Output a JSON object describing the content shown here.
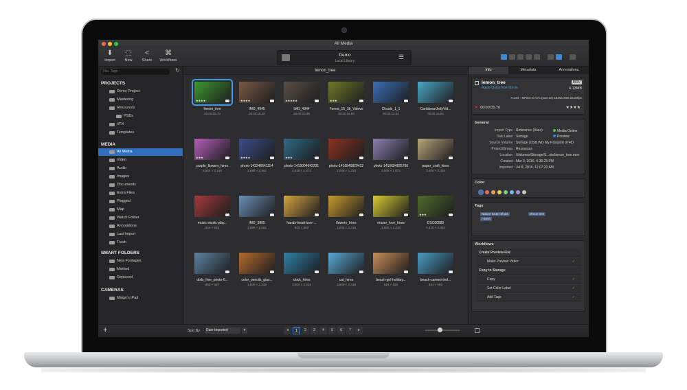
{
  "window": {
    "title": "All Media"
  },
  "toolbar": {
    "buttons": [
      {
        "label": "Import",
        "icon": "import-icon"
      },
      {
        "label": "New",
        "icon": "new-icon"
      },
      {
        "label": "Share",
        "icon": "share-icon"
      },
      {
        "label": "Workflows",
        "icon": "workflows-icon"
      }
    ],
    "library": {
      "name": "Demo",
      "subtitle": "Local Library"
    }
  },
  "sidebar": {
    "search_placeholder": "File, Tags",
    "sections": {
      "projects": "PROJECTS",
      "media": "MEDIA",
      "smart_folders": "SMART FOLDERS",
      "cameras": "CAMERAS"
    },
    "projects": [
      "Demo Project",
      "Mastering",
      "Resources",
      "PSDs",
      "VFX",
      "Templates"
    ],
    "media": [
      "All Media",
      "Video",
      "Audio",
      "Images",
      "Documents",
      "Extra Files",
      "Flagged",
      "Map",
      "Watch Folder",
      "Annotations",
      "Last Import",
      "Trash"
    ],
    "smart_folders": [
      "New Footages",
      "Marked",
      "Replaced"
    ],
    "cameras": [
      "Maign's iPad"
    ]
  },
  "center": {
    "breadcrumb": "lemon_tree",
    "items": [
      {
        "name": "lemon_tree",
        "sub": "00:00:05.76",
        "stars": "★★★★",
        "color": "#3d9a2f"
      },
      {
        "name": "IMG_4945",
        "sub": "00:00:18.26",
        "stars": "★★★★",
        "color": "#7a5a44"
      },
      {
        "name": "IMG_4944",
        "sub": "00:00:10.86",
        "stars": "★★★★★",
        "color": "#5a4f48"
      },
      {
        "name": "Forest_15_3b_Videvo",
        "sub": "00:00:16.64",
        "stars": "★★★",
        "color": "#6f7a28"
      },
      {
        "name": "Clouds_1_1",
        "sub": "00:00:12.52",
        "stars": "",
        "color": "#3b6fb8"
      },
      {
        "name": "CaribbeanJettyVid...",
        "sub": "00:00:16.64",
        "stars": "",
        "color": "#4aa6c8"
      },
      {
        "name": "purple_flowers_hires",
        "sub": "3,500 × 2,318",
        "stars": "★★★",
        "color": "#b45fb9"
      },
      {
        "name": "photo-142346641154",
        "sub": "3,888 × 2,592",
        "stars": "★★★★",
        "color": "#3c4e88"
      },
      {
        "name": "photo-1419004642331",
        "sub": "2,539 × 1,673",
        "stars": "★★★",
        "color": "#2f6a86"
      },
      {
        "name": "photo-1416849829422",
        "sub": "2,000 × 1,333",
        "stars": "",
        "color": "#8a3320"
      },
      {
        "name": "photo-1416694825760",
        "sub": "2,508 × 1,673",
        "stars": "",
        "color": "#8a7fb0"
      },
      {
        "name": "paper_craft_hires",
        "sub": "3,500 × 2,318",
        "stars": "",
        "color": "#b9a37a"
      },
      {
        "name": "music-music-play...",
        "sub": "824 × 550",
        "stars": "",
        "color": "#a33a3a"
      },
      {
        "name": "IMG_3865",
        "sub": "3,888 × 2,592",
        "stars": "",
        "color": "#6b8fb5"
      },
      {
        "name": "hands-heart-love-...",
        "sub": "824 × 550",
        "stars": "",
        "color": "#d4a341"
      },
      {
        "name": "flowers_hires",
        "sub": "3,500 × 2,318",
        "stars": "",
        "color": "#c79b2c"
      },
      {
        "name": "eraser_love_hires",
        "sub": "3,500 × 2,318",
        "stars": "",
        "color": "#d9cc2f"
      },
      {
        "name": "DSC00580",
        "sub": "4,310 × 2,864",
        "stars": "★★★",
        "color": "#4f6b2c"
      },
      {
        "name": "dolls_free_photo-6...",
        "sub": "660 × 457",
        "stars": "",
        "color": "#5b83a3"
      },
      {
        "name": "color_pencils_glas...",
        "sub": "3,500 × 2,318",
        "stars": "",
        "color": "#b46a2d"
      },
      {
        "name": "clock_hires",
        "sub": "3,500 × 2,318",
        "stars": "",
        "color": "#2f7fa8"
      },
      {
        "name": "cat_hires",
        "sub": "3,500 × 2,318",
        "stars": "",
        "color": "#5aa9d6"
      },
      {
        "name": "beach-girl-holiday...",
        "sub": "824 × 550",
        "stars": "",
        "color": "#c98d56"
      },
      {
        "name": "beach-camera-hol...",
        "sub": "824 × 550",
        "stars": "",
        "color": "#4a9cc3"
      }
    ]
  },
  "inspector": {
    "tabs": [
      "Info",
      "Metadata",
      "Annotations"
    ],
    "file": {
      "name": "lemon_tree",
      "badge": "MOV",
      "kind": "Apple QuickTime Movie",
      "size": "4.13MB",
      "codec": "H.264 - MPEG-4 AVC (part 10) 1920x1080 25.00fps",
      "duration": "00:00:05.76",
      "stars": "★★★★"
    },
    "general": {
      "title": "General",
      "rows": [
        {
          "k": "Import Type :",
          "v": "Reference (Alias)"
        },
        {
          "k": "Disk Label :",
          "v": "Storage"
        },
        {
          "k": "Source Volume :",
          "v": "Storage (USB WD My Passport 0748)"
        },
        {
          "k": "Project/Group :",
          "v": "Resources"
        },
        {
          "k": "Location :",
          "v": "/Volumes/Storage/S...ots/lemon_tree.mov"
        },
        {
          "k": "Created :",
          "v": "Mar 3, 2016, 6:36:25 PM"
        },
        {
          "k": "Imported :",
          "v": "Jul 8, 2016, 11:07:20 AM"
        }
      ],
      "status_online": "Media Online",
      "status_preview": "Preview"
    },
    "color": {
      "title": "Color",
      "swatches": [
        "#5a6f8f",
        "#e26b6b",
        "#e8a35a",
        "#e3d466",
        "#7fcf7a",
        "#79b8e8",
        "#a88fe0",
        "#c7c7c7"
      ]
    },
    "tags": {
      "title": "Tags",
      "items": [
        "Nature Insert Shots",
        "lemon tree",
        "Forest"
      ]
    },
    "workflows": {
      "title": "Workflows",
      "items": [
        {
          "label": "Create Preview File",
          "group": true
        },
        {
          "label": "Make Preview Video",
          "group": false
        },
        {
          "label": "Copy to Storage",
          "group": true
        },
        {
          "label": "Copy",
          "group": false
        },
        {
          "label": "Set Color Label",
          "group": false
        },
        {
          "label": "Add Tags",
          "group": false
        }
      ]
    }
  },
  "bottombar": {
    "sort_label": "Sort By:",
    "sort_value": "Date Imported",
    "pages": [
      "1",
      "2",
      "3",
      "4",
      "5",
      "6",
      "7"
    ]
  }
}
